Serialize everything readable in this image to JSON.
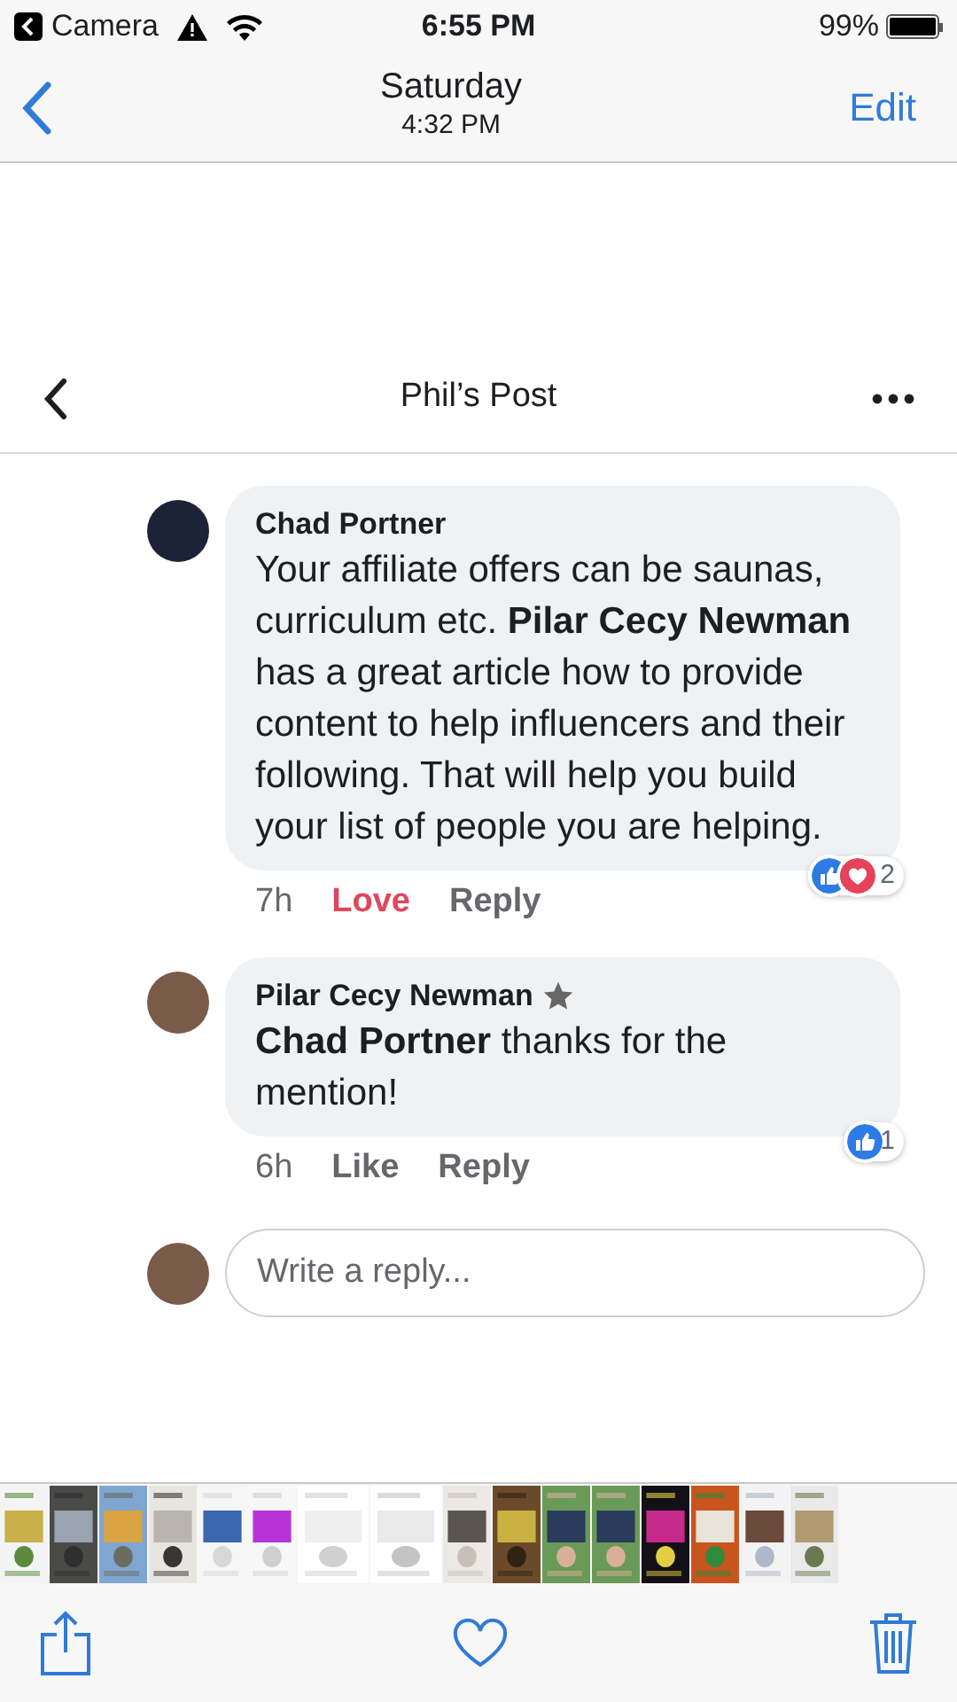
{
  "status_bar": {
    "back_label": "Camera",
    "time": "6:55 PM",
    "battery": "99%"
  },
  "nav": {
    "title": "Saturday",
    "subtitle": "4:32 PM",
    "edit": "Edit"
  },
  "post_header": {
    "title": "Phil’s Post"
  },
  "comments": [
    {
      "author": "Chad Portner",
      "badge": false,
      "text": "Your affiliate offers can be saunas, curriculum etc. **Pilar Cecy Newman** has a great article how to provide content to help influencers and their following. That will help you build your list of people you are helping.",
      "time": "7h",
      "actions": [
        {
          "label": "Love",
          "active": true
        },
        {
          "label": "Reply",
          "active": false
        }
      ],
      "reactions": [
        {
          "kind": "like"
        },
        {
          "kind": "love"
        }
      ],
      "reaction_count": "2"
    },
    {
      "author": "Pilar Cecy Newman",
      "badge": true,
      "text": "**Chad Portner** thanks for the mention!",
      "time": "6h",
      "actions": [
        {
          "label": "Like",
          "active": false
        },
        {
          "label": "Reply",
          "active": false
        }
      ],
      "reactions": [
        {
          "kind": "like"
        }
      ],
      "reaction_count": "1"
    }
  ],
  "reply_field": {
    "placeholder": "Write a reply..."
  },
  "toolbar": {
    "favorite": false
  }
}
